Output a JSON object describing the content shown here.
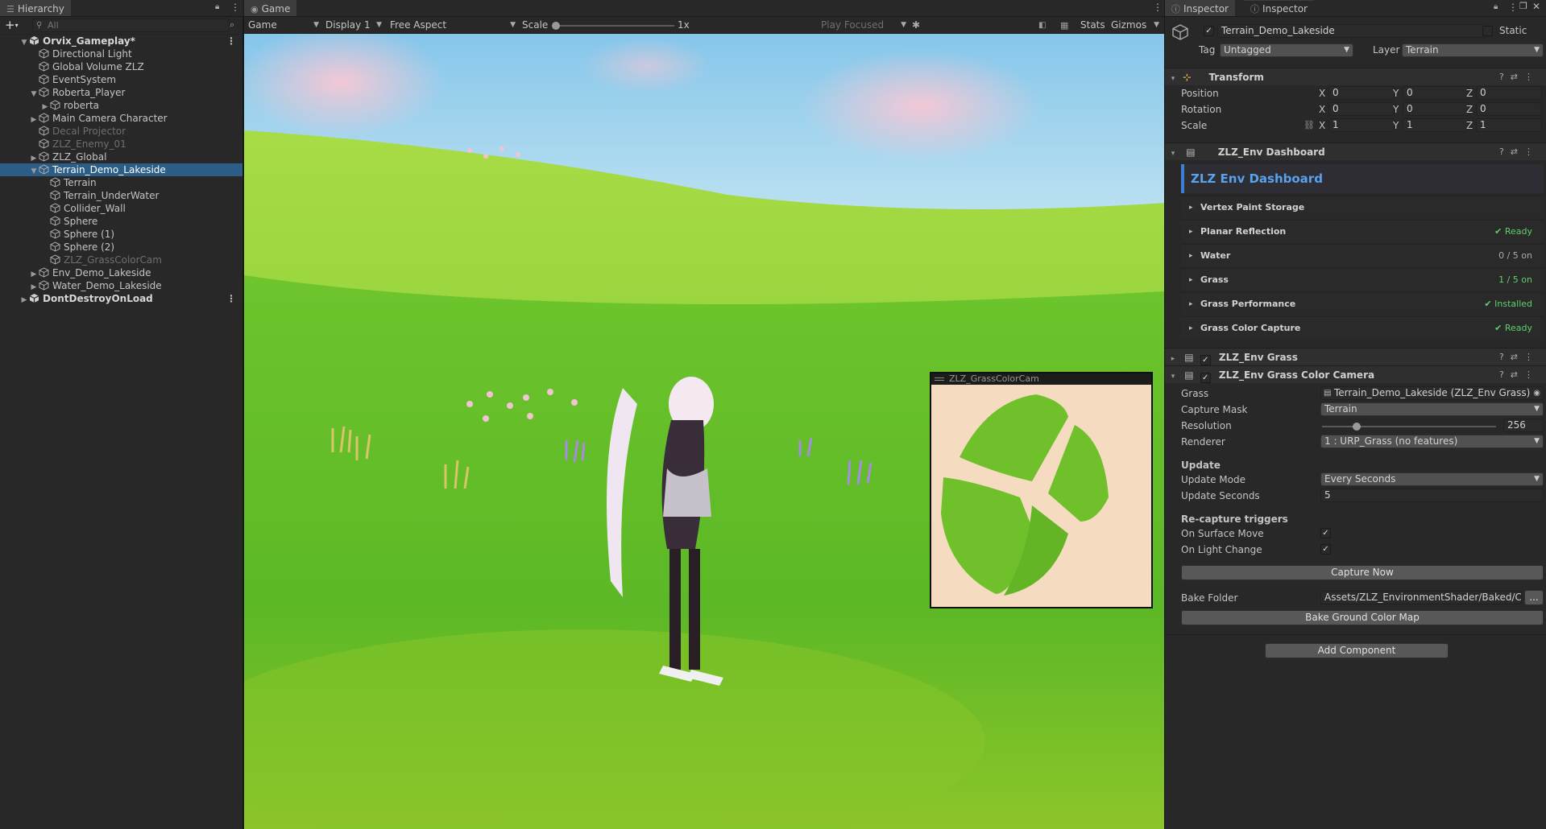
{
  "hierarchy": {
    "tab_label": "Hierarchy",
    "search_placeholder": "All",
    "items": [
      {
        "label": "Orvix_Gameplay*",
        "depth": 0,
        "arrow": "open",
        "kind": "scene"
      },
      {
        "label": "Directional Light",
        "depth": 1,
        "arrow": "none",
        "kind": "object"
      },
      {
        "label": "Global Volume ZLZ",
        "depth": 1,
        "arrow": "none",
        "kind": "object"
      },
      {
        "label": "EventSystem",
        "depth": 1,
        "arrow": "none",
        "kind": "object"
      },
      {
        "label": "Roberta_Player",
        "depth": 1,
        "arrow": "open",
        "kind": "object"
      },
      {
        "label": "roberta",
        "depth": 2,
        "arrow": "closed",
        "kind": "object"
      },
      {
        "label": "Main Camera Character",
        "depth": 1,
        "arrow": "closed",
        "kind": "object"
      },
      {
        "label": "Decal Projector",
        "depth": 1,
        "arrow": "none",
        "kind": "object",
        "dim": true
      },
      {
        "label": "ZLZ_Enemy_01",
        "depth": 1,
        "arrow": "none",
        "kind": "object",
        "dim": true
      },
      {
        "label": "ZLZ_Global",
        "depth": 1,
        "arrow": "closed",
        "kind": "object"
      },
      {
        "label": "Terrain_Demo_Lakeside",
        "depth": 1,
        "arrow": "open",
        "kind": "object",
        "selected": true
      },
      {
        "label": "Terrain",
        "depth": 2,
        "arrow": "none",
        "kind": "object"
      },
      {
        "label": "Terrain_UnderWater",
        "depth": 2,
        "arrow": "none",
        "kind": "object"
      },
      {
        "label": "Collider_Wall",
        "depth": 2,
        "arrow": "none",
        "kind": "object"
      },
      {
        "label": "Sphere",
        "depth": 2,
        "arrow": "none",
        "kind": "object"
      },
      {
        "label": "Sphere (1)",
        "depth": 2,
        "arrow": "none",
        "kind": "object"
      },
      {
        "label": "Sphere (2)",
        "depth": 2,
        "arrow": "none",
        "kind": "object"
      },
      {
        "label": "ZLZ_GrassColorCam",
        "depth": 2,
        "arrow": "none",
        "kind": "object",
        "dim": true
      },
      {
        "label": "Env_Demo_Lakeside",
        "depth": 1,
        "arrow": "closed",
        "kind": "object"
      },
      {
        "label": "Water_Demo_Lakeside",
        "depth": 1,
        "arrow": "closed",
        "kind": "object"
      },
      {
        "label": "DontDestroyOnLoad",
        "depth": 0,
        "arrow": "closed",
        "kind": "scene"
      }
    ]
  },
  "game": {
    "tab_label": "Game",
    "mode": "Game",
    "display": "Display 1",
    "aspect": "Free Aspect",
    "scale_label": "Scale",
    "scale_value": "1x",
    "play_focused": "Play Focused",
    "stats": "Stats",
    "gizmos": "Gizmos",
    "preview_title": "ZLZ_GrassColorCam"
  },
  "inspector": {
    "tab1": "Inspector",
    "tab2": "Inspector",
    "object_name": "Terrain_Demo_Lakeside",
    "static_label": "Static",
    "tag_label": "Tag",
    "tag_value": "Untagged",
    "layer_label": "Layer",
    "layer_value": "Terrain",
    "transform": {
      "title": "Transform",
      "position_label": "Position",
      "position": [
        "0",
        "0",
        "0"
      ],
      "rotation_label": "Rotation",
      "rotation": [
        "0",
        "0",
        "0"
      ],
      "scale_label": "Scale",
      "scale": [
        "1",
        "1",
        "1"
      ],
      "axis": [
        "X",
        "Y",
        "Z"
      ]
    },
    "dashboard": {
      "title": "ZLZ_Env Dashboard",
      "banner": "ZLZ Env Dashboard",
      "sections": [
        {
          "label": "Vertex Paint Storage",
          "status": "",
          "tone": "none"
        },
        {
          "label": "Planar Reflection",
          "status": "✔ Ready",
          "tone": "ok"
        },
        {
          "label": "Water",
          "status": "0 / 5 on",
          "tone": "gray"
        },
        {
          "label": "Grass",
          "status": "1 / 5 on",
          "tone": "ok"
        },
        {
          "label": "Grass Performance",
          "status": "✔ Installed",
          "tone": "ok"
        },
        {
          "label": "Grass Color Capture",
          "status": "✔ Ready",
          "tone": "ok"
        }
      ]
    },
    "env_grass_title": "ZLZ_Env Grass",
    "grass_cam": {
      "title": "ZLZ_Env Grass Color Camera",
      "grass_label": "Grass",
      "grass_value": "Terrain_Demo_Lakeside (ZLZ_Env Grass)",
      "capture_mask_label": "Capture Mask",
      "capture_mask_value": "Terrain",
      "resolution_label": "Resolution",
      "resolution_value": "256",
      "resolution_fraction": 0.2,
      "renderer_label": "Renderer",
      "renderer_value": "1 : URP_Grass  (no features)",
      "update_header": "Update",
      "update_mode_label": "Update Mode",
      "update_mode_value": "Every Seconds",
      "update_seconds_label": "Update Seconds",
      "update_seconds_value": "5",
      "recapture_header": "Re-capture triggers",
      "surface_move_label": "On Surface Move",
      "light_change_label": "On Light Change",
      "capture_now": "Capture Now",
      "bake_folder_label": "Bake Folder",
      "bake_folder_value": "Assets/ZLZ_EnvironmentShader/Baked/Co",
      "browse": "...",
      "bake_button": "Bake Ground Color Map"
    },
    "add_component": "Add Component"
  }
}
